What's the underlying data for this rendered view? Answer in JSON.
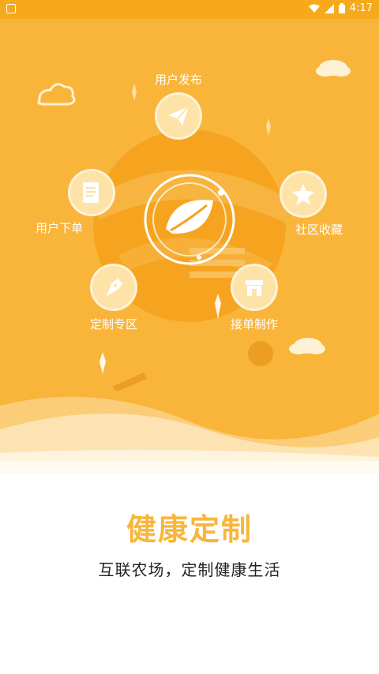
{
  "status_bar": {
    "time": "4:17",
    "icons": [
      "notification-icon",
      "wifi-icon",
      "signal-icon",
      "battery-icon"
    ]
  },
  "features": [
    {
      "id": "publish",
      "label": "用户发布",
      "icon": "paper-plane-icon"
    },
    {
      "id": "order",
      "label": "用户下单",
      "icon": "document-icon"
    },
    {
      "id": "collect",
      "label": "社区收藏",
      "icon": "star-icon"
    },
    {
      "id": "custom",
      "label": "定制专区",
      "icon": "pen-nib-icon"
    },
    {
      "id": "make",
      "label": "接单制作",
      "icon": "shop-icon"
    }
  ],
  "center_logo": {
    "icon": "leaf-icon"
  },
  "title": "健康定制",
  "subtitle": "互联农场，定制健康生活",
  "colors": {
    "background": "#F9B53A",
    "status_bar": "#F7A91C",
    "icon_circle": "#FDE3A8",
    "title": "#F8B63A",
    "subtitle": "#222222"
  }
}
